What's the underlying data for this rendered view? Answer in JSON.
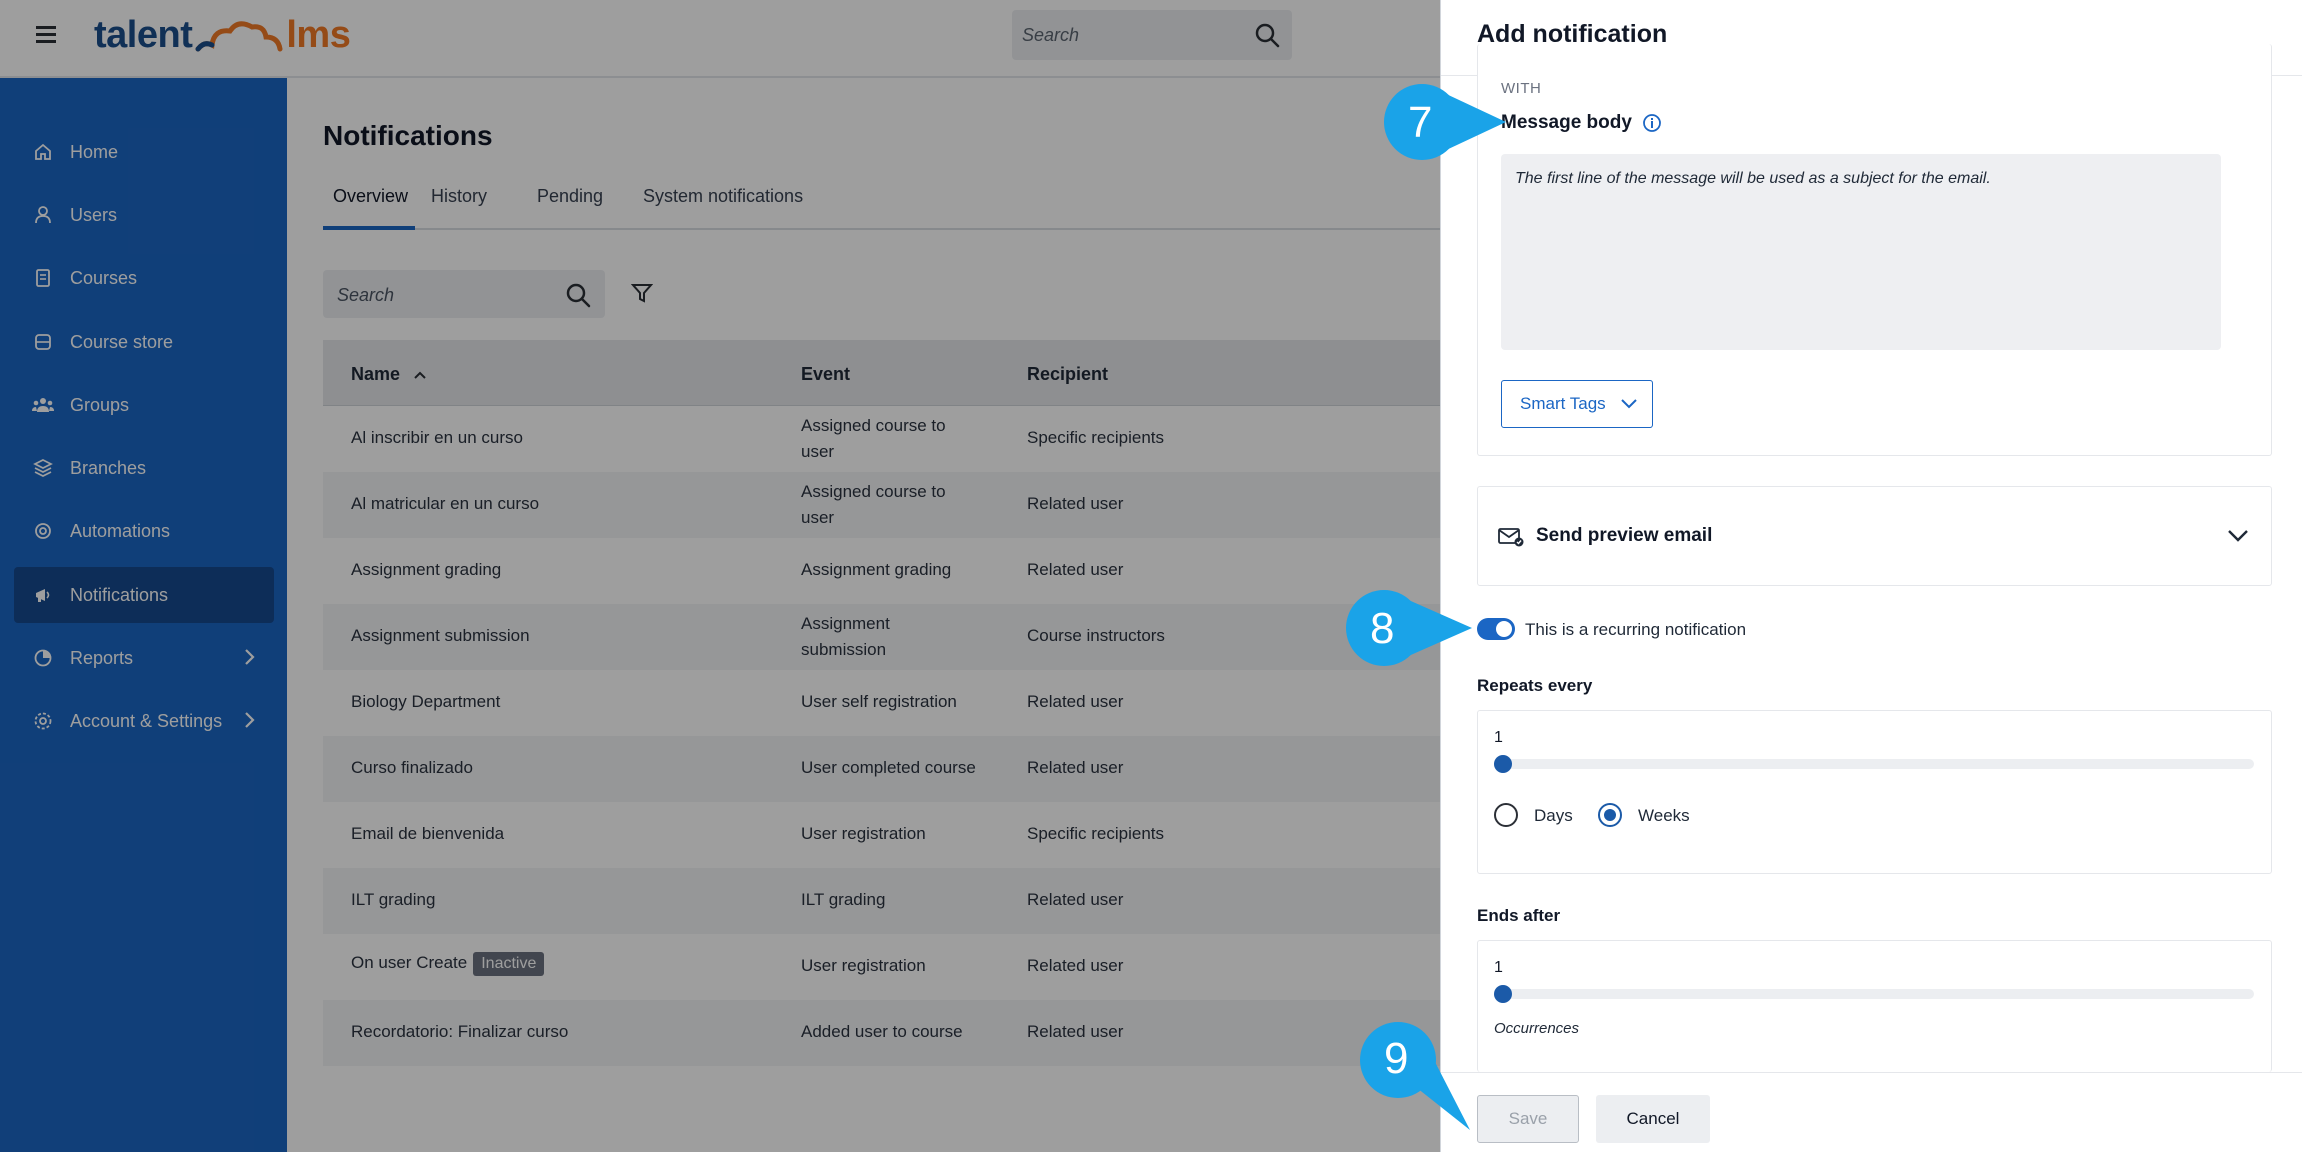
{
  "app": {
    "logo_left": "talent",
    "logo_right": "lms"
  },
  "topbar": {
    "search_placeholder": "Search"
  },
  "sidebar": {
    "items": [
      {
        "label": "Home",
        "icon": "home-icon"
      },
      {
        "label": "Users",
        "icon": "user-icon"
      },
      {
        "label": "Courses",
        "icon": "book-icon"
      },
      {
        "label": "Course store",
        "icon": "store-icon"
      },
      {
        "label": "Groups",
        "icon": "groups-icon"
      },
      {
        "label": "Branches",
        "icon": "branches-icon"
      },
      {
        "label": "Automations",
        "icon": "automations-icon"
      },
      {
        "label": "Notifications",
        "icon": "megaphone-icon",
        "active": true
      },
      {
        "label": "Reports",
        "icon": "pie-chart-icon",
        "has_submenu": true
      },
      {
        "label": "Account & Settings",
        "icon": "gear-icon",
        "has_submenu": true
      }
    ]
  },
  "main": {
    "title": "Notifications",
    "tabs": [
      "Overview",
      "History",
      "Pending",
      "System notifications"
    ],
    "active_tab": "Overview",
    "search_placeholder": "Search",
    "table": {
      "headers": {
        "name": "Name",
        "event": "Event",
        "recipient": "Recipient"
      },
      "rows": [
        {
          "name": "Al inscribir en un curso",
          "event_l1": "Assigned course to",
          "event_l2": "user",
          "recipient": "Specific recipients"
        },
        {
          "name": "Al matricular en un curso",
          "event_l1": "Assigned course to",
          "event_l2": "user",
          "recipient": "Related user"
        },
        {
          "name": "Assignment grading",
          "event_l1": "Assignment grading",
          "event_l2": "",
          "recipient": "Related user"
        },
        {
          "name": "Assignment submission",
          "event_l1": "Assignment",
          "event_l2": "submission",
          "recipient": "Course instructors"
        },
        {
          "name": "Biology Department",
          "event_l1": "User self registration",
          "event_l2": "",
          "recipient": "Related user"
        },
        {
          "name": "Curso finalizado",
          "event_l1": "User completed course",
          "event_l2": "",
          "recipient": "Related user"
        },
        {
          "name": "Email de bienvenida",
          "event_l1": "User registration",
          "event_l2": "",
          "recipient": "Specific recipients"
        },
        {
          "name": "ILT grading",
          "event_l1": "ILT grading",
          "event_l2": "",
          "recipient": "Related user"
        },
        {
          "name": "On user Create",
          "badge": "Inactive",
          "event_l1": "User registration",
          "event_l2": "",
          "recipient": "Related user"
        },
        {
          "name": "Recordatorio: Finalizar curso",
          "event_l1": "Added user to course",
          "event_l2": "",
          "recipient": "Related user"
        }
      ]
    }
  },
  "drawer": {
    "title": "Add notification",
    "with_label": "WITH",
    "message_body_label": "Message body",
    "message_body_value": "The first line of the message will be used as a subject for the email.",
    "smart_tags_label": "Smart Tags",
    "send_preview_label": "Send preview email",
    "recurring_label": "This is a recurring notification",
    "recurring_on": true,
    "repeats_label": "Repeats every",
    "repeats_value": "1",
    "unit_options": [
      "Days",
      "Weeks"
    ],
    "unit_selected": "Weeks",
    "ends_label": "Ends after",
    "ends_value": "1",
    "ends_unit": "Occurrences",
    "save_label": "Save",
    "cancel_label": "Cancel"
  },
  "callouts": [
    "7",
    "8",
    "9"
  ],
  "colors": {
    "brand_blue": "#1b66c4",
    "logo_orange": "#f07a26",
    "callout": "#1aa3e8"
  }
}
